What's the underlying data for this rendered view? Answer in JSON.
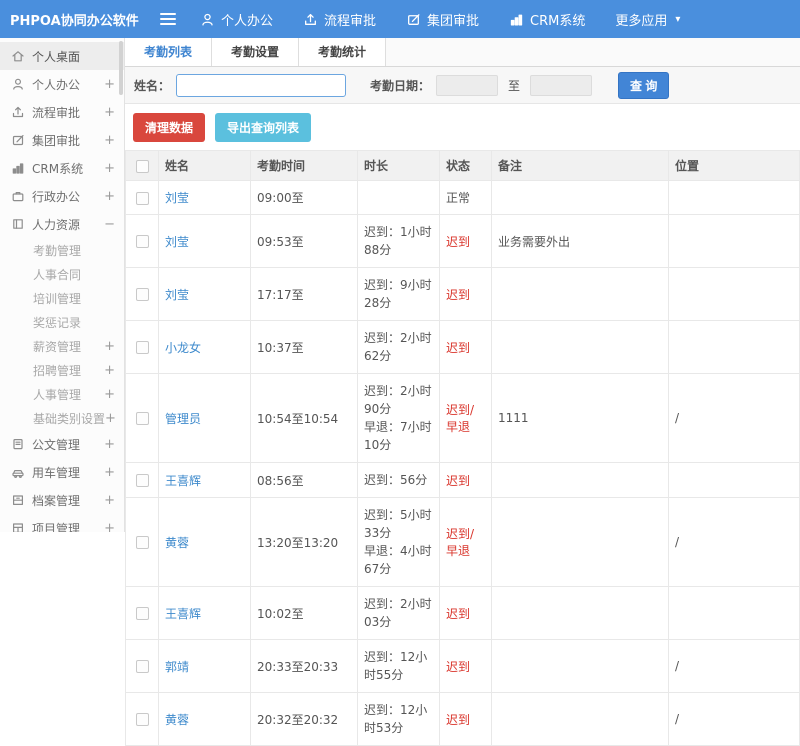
{
  "colors": {
    "topbar": "#4a8fdd",
    "primary_button": "#4285d6",
    "danger_button": "#d9473d",
    "info_button": "#5bc0de",
    "link": "#3e8acc",
    "late_status": "#d9342b"
  },
  "topbar": {
    "logo": "PHPOA协同办公软件",
    "caret": "▾",
    "nav": [
      {
        "label": "个人办公",
        "icon": "user-icon"
      },
      {
        "label": "流程审批",
        "icon": "flow-icon"
      },
      {
        "label": "集团审批",
        "icon": "edit-icon"
      },
      {
        "label": "CRM系统",
        "icon": "chart-icon"
      },
      {
        "label": "更多应用",
        "icon": "",
        "caret": true
      }
    ]
  },
  "sidebar": {
    "items": [
      {
        "label": "个人桌面",
        "icon": "home-icon",
        "expand": "",
        "active": true
      },
      {
        "label": "个人办公",
        "icon": "user-icon",
        "expand": "+"
      },
      {
        "label": "流程审批",
        "icon": "flow-icon",
        "expand": "+"
      },
      {
        "label": "集团审批",
        "icon": "edit-icon",
        "expand": "+"
      },
      {
        "label": "CRM系统",
        "icon": "chart-icon",
        "expand": "+"
      },
      {
        "label": "行政办公",
        "icon": "briefcase-icon",
        "expand": "+"
      },
      {
        "label": "人力资源",
        "icon": "hr-icon",
        "expand": "−"
      },
      {
        "label": "考勤管理",
        "sub": true,
        "expand": ""
      },
      {
        "label": "人事合同",
        "sub": true,
        "expand": ""
      },
      {
        "label": "培训管理",
        "sub": true,
        "expand": ""
      },
      {
        "label": "奖惩记录",
        "sub": true,
        "expand": ""
      },
      {
        "label": "薪资管理",
        "sub": true,
        "expand": "+"
      },
      {
        "label": "招聘管理",
        "sub": true,
        "expand": "+"
      },
      {
        "label": "人事管理",
        "sub": true,
        "expand": "+"
      },
      {
        "label": "基础类别设置",
        "sub": true,
        "expand": "+"
      },
      {
        "label": "公文管理",
        "icon": "doc-icon",
        "expand": "+"
      },
      {
        "label": "用车管理",
        "icon": "car-icon",
        "expand": "+"
      },
      {
        "label": "档案管理",
        "icon": "archive-icon",
        "expand": "+"
      },
      {
        "label": "项目管理",
        "icon": "project-icon",
        "expand": "+"
      }
    ]
  },
  "tabs": [
    {
      "label": "考勤列表",
      "active": true
    },
    {
      "label": "考勤设置",
      "active": false
    },
    {
      "label": "考勤统计",
      "active": false
    }
  ],
  "search": {
    "name_label": "姓名：",
    "name_value": "",
    "date_label": "考勤日期：",
    "date_from": "",
    "to_label": "至",
    "date_to": "",
    "query_button": "查 询"
  },
  "actions": {
    "clean_button": "清理数据",
    "export_button": "导出查询列表"
  },
  "table": {
    "headers": [
      "姓名",
      "考勤时间",
      "时长",
      "状态",
      "备注",
      "位置"
    ],
    "rows": [
      {
        "name": "刘莹",
        "time": "09:00至",
        "duration": [],
        "status": "正常",
        "status_type": "normal",
        "note": "",
        "location": ""
      },
      {
        "name": "刘莹",
        "time": "09:53至",
        "duration": [
          "迟到：1小时88分"
        ],
        "status": "迟到",
        "status_type": "late",
        "note": "业务需要外出",
        "location": ""
      },
      {
        "name": "刘莹",
        "time": "17:17至",
        "duration": [
          "迟到：9小时28分"
        ],
        "status": "迟到",
        "status_type": "late",
        "note": "",
        "location": ""
      },
      {
        "name": "小龙女",
        "time": "10:37至",
        "duration": [
          "迟到：2小时62分"
        ],
        "status": "迟到",
        "status_type": "late",
        "note": "",
        "location": ""
      },
      {
        "name": "管理员",
        "time": "10:54至10:54",
        "duration": [
          "迟到：2小时90分",
          "早退：7小时10分"
        ],
        "status": "迟到/早退",
        "status_type": "late",
        "note": "1111",
        "location": "/"
      },
      {
        "name": "王喜辉",
        "time": "08:56至",
        "duration": [
          "迟到：56分"
        ],
        "status": "迟到",
        "status_type": "late",
        "note": "",
        "location": ""
      },
      {
        "name": "黄蓉",
        "time": "13:20至13:20",
        "duration": [
          "迟到：5小时33分",
          "早退：4小时67分"
        ],
        "status": "迟到/早退",
        "status_type": "late",
        "note": "",
        "location": "/"
      },
      {
        "name": "王喜辉",
        "time": "10:02至",
        "duration": [
          "迟到：2小时03分"
        ],
        "status": "迟到",
        "status_type": "late",
        "note": "",
        "location": ""
      },
      {
        "name": "郭靖",
        "time": "20:33至20:33",
        "duration": [
          "迟到：12小时55分"
        ],
        "status": "迟到",
        "status_type": "late",
        "note": "",
        "location": "/"
      },
      {
        "name": "黄蓉",
        "time": "20:32至20:32",
        "duration": [
          "迟到：12小时53分"
        ],
        "status": "迟到",
        "status_type": "late",
        "note": "",
        "location": "/"
      }
    ]
  }
}
